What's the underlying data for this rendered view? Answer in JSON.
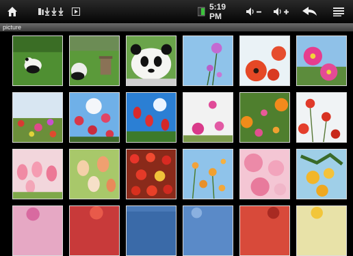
{
  "header": {
    "time": "5:19 PM",
    "title": "picture"
  },
  "icons": {
    "home": "home-icon",
    "downloads": "download-icon",
    "media": "play-icon",
    "battery": "battery-icon",
    "volume_down": "volume-down-icon",
    "volume_up": "volume-up-icon",
    "back": "back-arrow-icon",
    "menu": "menu-icon"
  },
  "gallery": {
    "items": [
      {
        "subject": "panda-grass"
      },
      {
        "subject": "panda-grass-2"
      },
      {
        "subject": "panda-closeup"
      },
      {
        "subject": "flower-sky"
      },
      {
        "subject": "red-poppies"
      },
      {
        "subject": "pink-flowers"
      },
      {
        "subject": "flower-field"
      },
      {
        "subject": "red-flowers-sun"
      },
      {
        "subject": "tulips-blue-sky"
      },
      {
        "subject": "white-pink-flowers"
      },
      {
        "subject": "orange-flowers"
      },
      {
        "subject": "red-poppies-white"
      },
      {
        "subject": "pink-tulips"
      },
      {
        "subject": "tulips-green"
      },
      {
        "subject": "red-tulips"
      },
      {
        "subject": "orange-sky-flowers"
      },
      {
        "subject": "pink-blossoms"
      },
      {
        "subject": "yellow-flowers"
      },
      {
        "subject": "pink-partial"
      },
      {
        "subject": "red-partial"
      },
      {
        "subject": "blue-partial"
      },
      {
        "subject": "blue-partial-2"
      },
      {
        "subject": "red-partial-2"
      },
      {
        "subject": "yellow-partial"
      }
    ]
  },
  "colors": {
    "statusbar": "#0a0a0a",
    "titlebar": "#555555",
    "battery_green": "#3cc23c"
  }
}
